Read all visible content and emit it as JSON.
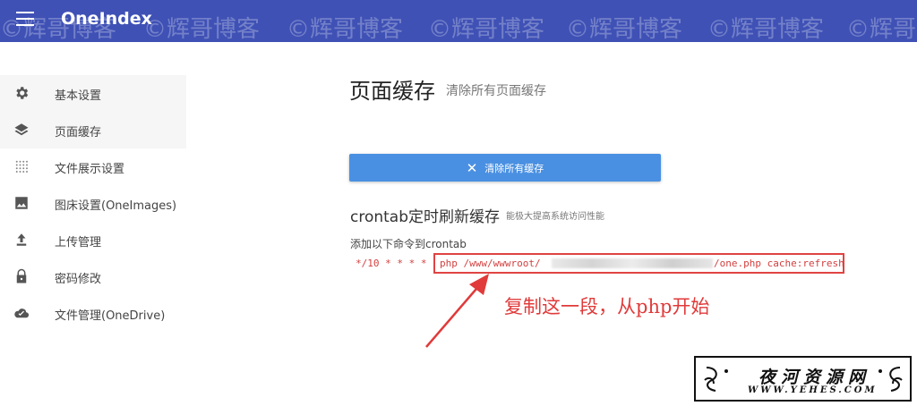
{
  "app": {
    "title": "OneIndex",
    "header_color": "#3f51b5"
  },
  "watermark": "©辉哥博客",
  "sidebar": {
    "items": [
      {
        "label": "基本设置",
        "icon": "gear-icon"
      },
      {
        "label": "页面缓存",
        "icon": "layers-icon"
      },
      {
        "label": "文件展示设置",
        "icon": "grid-dots-icon"
      },
      {
        "label": "图床设置(OneImages)",
        "icon": "image-icon"
      },
      {
        "label": "上传管理",
        "icon": "upload-icon"
      },
      {
        "label": "密码修改",
        "icon": "lock-icon"
      },
      {
        "label": "文件管理(OneDrive)",
        "icon": "cloud-icon"
      }
    ]
  },
  "main": {
    "title": "页面缓存",
    "subtitle": "清除所有页面缓存",
    "clear_button": "清除所有缓存",
    "cron_title": "crontab定时刷新缓存",
    "cron_subtitle": "能极大提高系统访问性能",
    "add_label": "添加以下命令到crontab",
    "cron_schedule": "*/10 * * * *",
    "cmd_start": "php /www/wwwroot/",
    "cmd_end": "/one.php cache:refresh",
    "button_color": "#4a90e2"
  },
  "annotation": {
    "text": "复制这一段，从php开始",
    "color": "#e03a3a"
  },
  "logo": {
    "main": "夜河资源网",
    "url": "WWW.YEHES.COM"
  }
}
